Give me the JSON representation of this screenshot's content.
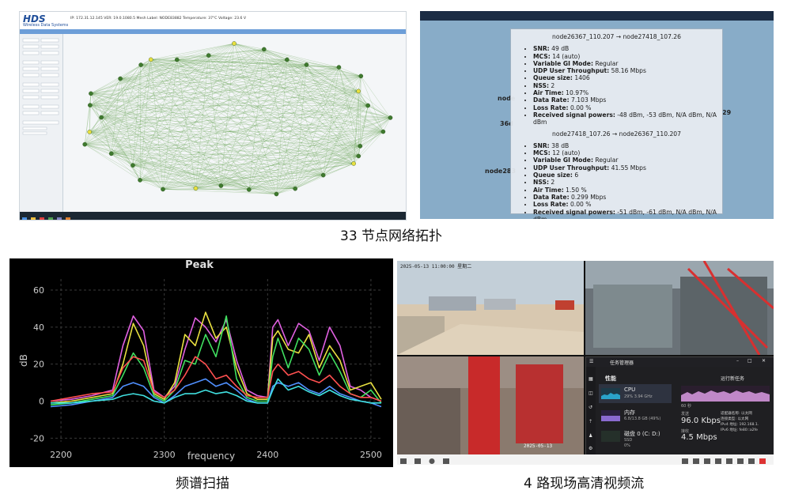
{
  "panel1": {
    "logo": "HDS",
    "logo_subtitle": "Wireless Data Systems",
    "header_info": "IP: 172.31.12.145  VER: 19.0.1080.5  Mesh Label: NODE83882  Temperature: 37°C  Voltage: 23.6 V",
    "caption": "33 节点网络拓扑"
  },
  "panel2": {
    "tooltip_title_1": "node26367_110.207 → node27418_107.26",
    "stats_1": [
      {
        "k": "SNR:",
        "v": " 49 dB"
      },
      {
        "k": "MCS:",
        "v": " 14 (auto)"
      },
      {
        "k": "Variable GI Mode:",
        "v": " Regular"
      },
      {
        "k": "UDP User Throughput:",
        "v": " 58.16 Mbps"
      },
      {
        "k": "Queue size:",
        "v": " 1406"
      },
      {
        "k": "NSS:",
        "v": " 2"
      },
      {
        "k": "Air Time:",
        "v": " 10.97%"
      },
      {
        "k": "Data Rate:",
        "v": " 7.103 Mbps"
      },
      {
        "k": "Loss Rate:",
        "v": " 0.00 %"
      },
      {
        "k": "Received signal powers:",
        "v": " -48 dBm, -53 dBm, N/A dBm, N/A dBm"
      }
    ],
    "tooltip_title_2": "node27418_107.26 → node26367_110.207",
    "stats_2": [
      {
        "k": "SNR:",
        "v": " 38 dB"
      },
      {
        "k": "MCS:",
        "v": " 12 (auto)"
      },
      {
        "k": "Variable GI Mode:",
        "v": " Regular"
      },
      {
        "k": "UDP User Throughput:",
        "v": " 41.55 Mbps"
      },
      {
        "k": "Queue size:",
        "v": " 6"
      },
      {
        "k": "NSS:",
        "v": " 2"
      },
      {
        "k": "Air Time:",
        "v": " 1.50 %"
      },
      {
        "k": "Data Rate:",
        "v": " 0.299 Mbps"
      },
      {
        "k": "Loss Rate:",
        "v": " 0.00 %"
      },
      {
        "k": "Received signal powers:",
        "v": " -51 dBm, -61 dBm, N/A dBm, N/A dBm"
      }
    ],
    "node_label_a": "node",
    "node_label_b": "36d",
    "node_label_c": "node283",
    "node_label_d": "29"
  },
  "panel3": {
    "caption": "频谱扫描",
    "chart_data": {
      "type": "line",
      "title": "Peak",
      "xlabel": "frequency",
      "ylabel": "dB",
      "xlim": [
        2190,
        2510
      ],
      "ylim": [
        -22,
        66
      ],
      "xticks": [
        2200,
        2300,
        2400,
        2500
      ],
      "yticks": [
        -20,
        0,
        20,
        40,
        60
      ],
      "grid": true,
      "series": [
        {
          "color": "#e060e0",
          "x": [
            2190,
            2210,
            2230,
            2250,
            2260,
            2270,
            2280,
            2290,
            2300,
            2310,
            2320,
            2330,
            2340,
            2350,
            2360,
            2370,
            2380,
            2390,
            2400,
            2405,
            2410,
            2420,
            2430,
            2440,
            2450,
            2460,
            2470,
            2480,
            2490,
            2500,
            2510
          ],
          "y": [
            0,
            1,
            3,
            6,
            30,
            46,
            38,
            6,
            2,
            8,
            28,
            45,
            40,
            32,
            44,
            22,
            6,
            3,
            2,
            40,
            44,
            30,
            42,
            38,
            22,
            40,
            30,
            8,
            6,
            2,
            0
          ]
        },
        {
          "color": "#e8e040",
          "x": [
            2190,
            2210,
            2230,
            2250,
            2260,
            2270,
            2280,
            2290,
            2300,
            2310,
            2320,
            2330,
            2340,
            2350,
            2360,
            2370,
            2380,
            2390,
            2400,
            2405,
            2410,
            2420,
            2430,
            2440,
            2450,
            2460,
            2470,
            2480,
            2490,
            2500,
            2510
          ],
          "y": [
            -1,
            0,
            2,
            4,
            20,
            42,
            30,
            4,
            1,
            10,
            36,
            30,
            48,
            34,
            40,
            18,
            4,
            1,
            1,
            34,
            38,
            28,
            26,
            36,
            18,
            30,
            22,
            6,
            8,
            10,
            1
          ]
        },
        {
          "color": "#40e060",
          "x": [
            2190,
            2210,
            2230,
            2250,
            2260,
            2270,
            2280,
            2290,
            2300,
            2310,
            2320,
            2330,
            2340,
            2350,
            2360,
            2370,
            2380,
            2390,
            2400,
            2405,
            2410,
            2420,
            2430,
            2440,
            2450,
            2460,
            2470,
            2480,
            2490,
            2500,
            2510
          ],
          "y": [
            -2,
            -1,
            1,
            3,
            14,
            26,
            18,
            3,
            0,
            6,
            22,
            20,
            36,
            24,
            46,
            12,
            2,
            0,
            0,
            24,
            34,
            18,
            34,
            28,
            14,
            26,
            16,
            4,
            2,
            6,
            -1
          ]
        },
        {
          "color": "#ff5050",
          "x": [
            2190,
            2210,
            2230,
            2250,
            2260,
            2270,
            2280,
            2290,
            2300,
            2310,
            2320,
            2330,
            2340,
            2350,
            2360,
            2370,
            2380,
            2390,
            2400,
            2405,
            2410,
            2420,
            2430,
            2440,
            2450,
            2460,
            2470,
            2480,
            2490,
            2500,
            2510
          ],
          "y": [
            0,
            2,
            4,
            5,
            18,
            24,
            22,
            5,
            2,
            6,
            14,
            24,
            20,
            12,
            14,
            8,
            3,
            2,
            2,
            16,
            20,
            14,
            16,
            12,
            10,
            14,
            8,
            4,
            2,
            2,
            0
          ]
        },
        {
          "color": "#5090ff",
          "x": [
            2190,
            2210,
            2230,
            2250,
            2260,
            2270,
            2280,
            2290,
            2300,
            2310,
            2320,
            2330,
            2340,
            2350,
            2360,
            2370,
            2380,
            2390,
            2400,
            2405,
            2410,
            2420,
            2430,
            2440,
            2450,
            2460,
            2470,
            2480,
            2490,
            2500,
            2510
          ],
          "y": [
            -3,
            -2,
            0,
            2,
            8,
            10,
            8,
            2,
            -1,
            3,
            8,
            10,
            12,
            8,
            10,
            6,
            1,
            -1,
            -1,
            8,
            10,
            8,
            10,
            6,
            4,
            8,
            4,
            2,
            0,
            -1,
            -3
          ]
        },
        {
          "color": "#40e0e0",
          "x": [
            2190,
            2210,
            2230,
            2250,
            2260,
            2270,
            2280,
            2290,
            2300,
            2310,
            2320,
            2330,
            2340,
            2350,
            2360,
            2370,
            2380,
            2390,
            2400,
            2405,
            2410,
            2420,
            2430,
            2440,
            2450,
            2460,
            2470,
            2480,
            2490,
            2500,
            2510
          ],
          "y": [
            -1,
            -1,
            0,
            1,
            3,
            4,
            3,
            0,
            -1,
            2,
            4,
            4,
            6,
            4,
            5,
            3,
            0,
            -1,
            -1,
            6,
            12,
            6,
            8,
            5,
            3,
            6,
            3,
            1,
            0,
            -1,
            -1
          ]
        }
      ]
    }
  },
  "panel4": {
    "caption": "4 路现场高清视频流",
    "cam1_stamp": "2025-05-13 11:00:00 星期二",
    "cam3_stamp": "2025-05-13",
    "taskmgr": {
      "title": "任务管理器",
      "section": "性能",
      "run_task": "运行新任务",
      "cpu_label": "CPU",
      "cpu_sub": "29% 3.94 GHz",
      "mem_label": "内存",
      "mem_sub": "6.8/13.8 GB (49%)",
      "disk_label": "磁盘 0 (C: D:)",
      "disk_sub": "SSD",
      "disk_sub2": "0%",
      "seconds": "60 秒",
      "send_label": "发送",
      "send_value": "96.0 Kbps",
      "recv_label": "接收",
      "recv_value": "4.5 Mbps",
      "adapter_k": "适配器名称:",
      "adapter_v": "以太网",
      "conn_k": "连接类型:",
      "conn_v": "以太网",
      "ipv4_k": "IPv4 地址:",
      "ipv4_v": "192.168.1.",
      "ipv6_k": "IPv6 地址:",
      "ipv6_v": "fe80::a2fe"
    }
  }
}
